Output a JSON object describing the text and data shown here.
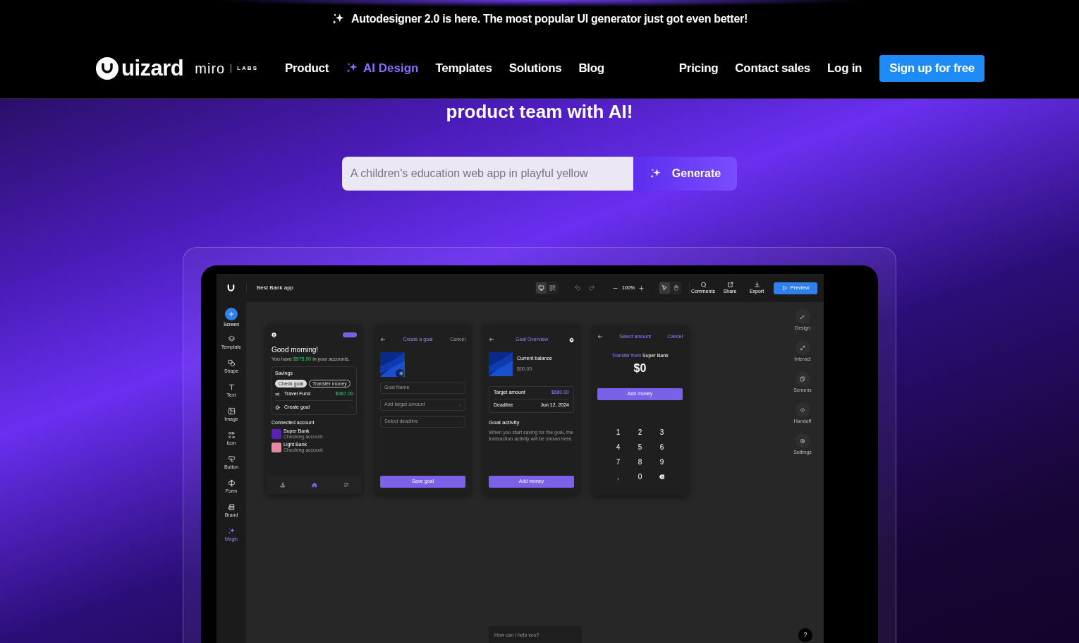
{
  "announcement": {
    "text": "Autodesigner 2.0 is here. The most popular UI generator just got even better!"
  },
  "nav": {
    "logo": "uizard",
    "partner": "miro",
    "partner_tag": "LABS",
    "links": [
      {
        "label": "Product",
        "kind": "plain"
      },
      {
        "label": "AI Design",
        "kind": "ai"
      },
      {
        "label": "Templates",
        "kind": "plain"
      },
      {
        "label": "Solutions",
        "kind": "plain"
      },
      {
        "label": "Blog",
        "kind": "plain"
      }
    ],
    "right_links": [
      "Pricing",
      "Contact sales",
      "Log in"
    ],
    "cta": "Sign up for free"
  },
  "hero": {
    "headline": "product team with AI!",
    "prompt_placeholder": "A children's education web app in playful yellow",
    "generate": "Generate"
  },
  "editor": {
    "project": "Best Bank app",
    "view_modes": [
      {
        "selected": true
      },
      {
        "selected": false
      }
    ],
    "zoom": "100%",
    "canvas_modes": [
      {
        "selected": true
      },
      {
        "selected": false
      }
    ],
    "actions": [
      "Comments",
      "Share",
      "Export"
    ],
    "preview": "Preview",
    "tools": [
      {
        "label": "Screen",
        "kind": "primary"
      },
      {
        "label": "Template",
        "kind": "plain"
      },
      {
        "label": "Shape",
        "kind": "plain"
      },
      {
        "label": "Text",
        "kind": "plain"
      },
      {
        "label": "Image",
        "kind": "plain"
      },
      {
        "label": "Icon",
        "kind": "plain"
      },
      {
        "label": "Button",
        "kind": "plain"
      },
      {
        "label": "Form",
        "kind": "plain"
      },
      {
        "label": "Brand",
        "kind": "plain"
      },
      {
        "label": "Magic",
        "kind": "magic"
      }
    ],
    "panels": [
      "Design",
      "Interact",
      "Screens",
      "Handoff",
      "Settings"
    ],
    "assistant_placeholder": "How can I help you?",
    "help": "?"
  },
  "screens": [
    {
      "kind": "home",
      "greeting": "Good morning!",
      "balance": "You have **$975.00** in your accounts.",
      "savings": {
        "title": "Savings",
        "chips": [
          {
            "label": "Check goal",
            "selected": true
          },
          {
            "label": "Transfer money",
            "selected": false
          }
        ],
        "goal": "Travel Fund",
        "goal_amount": "$467.00",
        "create": "Create goal"
      },
      "accounts_title": "Connected account",
      "accounts": [
        {
          "name": "Super Bank",
          "type": "Checking account",
          "color": "#5b21b6"
        },
        {
          "name": "Light Bank",
          "type": "Checking account",
          "color": "#e58aa0"
        }
      ],
      "tabs": [
        {
          "selected": false
        },
        {
          "selected": true
        },
        {
          "selected": false
        }
      ]
    },
    {
      "kind": "create_goal",
      "title": "Create a goal",
      "cancel": "Cancel",
      "fields": [
        {
          "placeholder": "Goal Name",
          "kind": "text"
        },
        {
          "placeholder": "Add target amount",
          "kind": "amount"
        },
        {
          "placeholder": "Select deadline",
          "kind": "date"
        }
      ],
      "button": "Save goal"
    },
    {
      "kind": "overview",
      "title": "Goal Overview",
      "balance_label": "Current balance",
      "balance": "$00.00",
      "details": [
        {
          "label": "Target amount",
          "value": "$680.00",
          "kind": "money"
        },
        {
          "label": "Deadline",
          "value": "Jun 12, 2024",
          "kind": "date"
        }
      ],
      "activity_title": "Goal activity",
      "activity_text": "When you start saving for the goal, the transaction activity will be shown here.",
      "button": "Add money"
    },
    {
      "kind": "amount",
      "title": "Select amount",
      "cancel": "Cancel",
      "source": "Transfer from **Super Bank**",
      "amount": "$0",
      "button": "Add money",
      "keys": [
        "1",
        "2",
        "3",
        "4",
        "5",
        "6",
        "7",
        "8",
        "9",
        ",",
        "0"
      ]
    }
  ]
}
